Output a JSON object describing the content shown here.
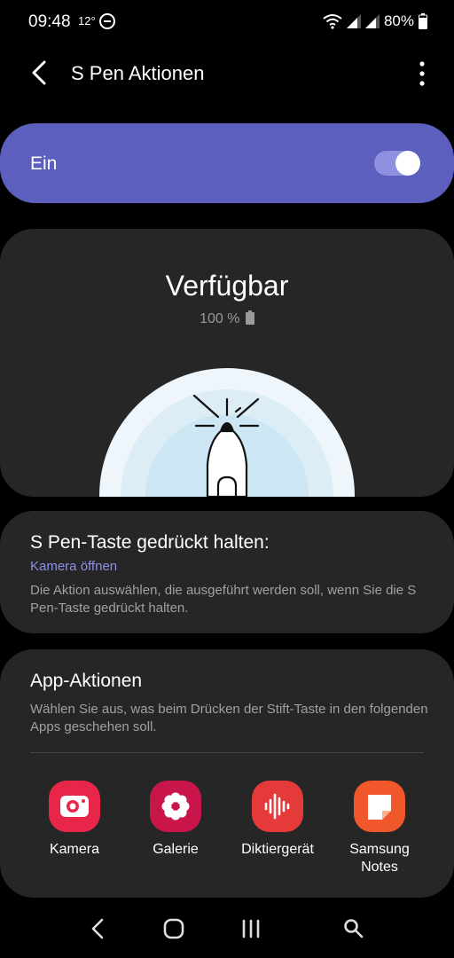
{
  "status_bar": {
    "time": "09:48",
    "temperature": "12°",
    "battery_text": "80%"
  },
  "app_bar": {
    "title": "S Pen Aktionen"
  },
  "main_toggle": {
    "label": "Ein",
    "state": true,
    "accent_color": "#5d5fbf"
  },
  "pen_status": {
    "title": "Verfügbar",
    "battery": "100 %"
  },
  "press_hold": {
    "title": "S Pen-Taste gedrückt halten:",
    "value": "Kamera öffnen",
    "description": "Die Aktion auswählen, die ausgeführt werden soll, wenn Sie die S Pen-Taste gedrückt halten."
  },
  "app_actions": {
    "title": "App-Aktionen",
    "description": "Wählen Sie aus, was beim Drücken der Stift-Taste in den folgenden Apps geschehen soll.",
    "apps": [
      {
        "label": "Kamera",
        "icon": "camera-icon",
        "color": "#e8264a"
      },
      {
        "label": "Galerie",
        "icon": "flower-icon",
        "color": "#c8154a"
      },
      {
        "label": "Diktiergerät",
        "icon": "waveform-icon",
        "color": "#e53a3a"
      },
      {
        "label": "Samsung\nNotes",
        "icon": "note-icon",
        "color": "#f0572a"
      }
    ]
  },
  "nav_bar": {
    "icons": [
      "back-icon",
      "home-icon",
      "recents-icon",
      "search-icon"
    ]
  }
}
